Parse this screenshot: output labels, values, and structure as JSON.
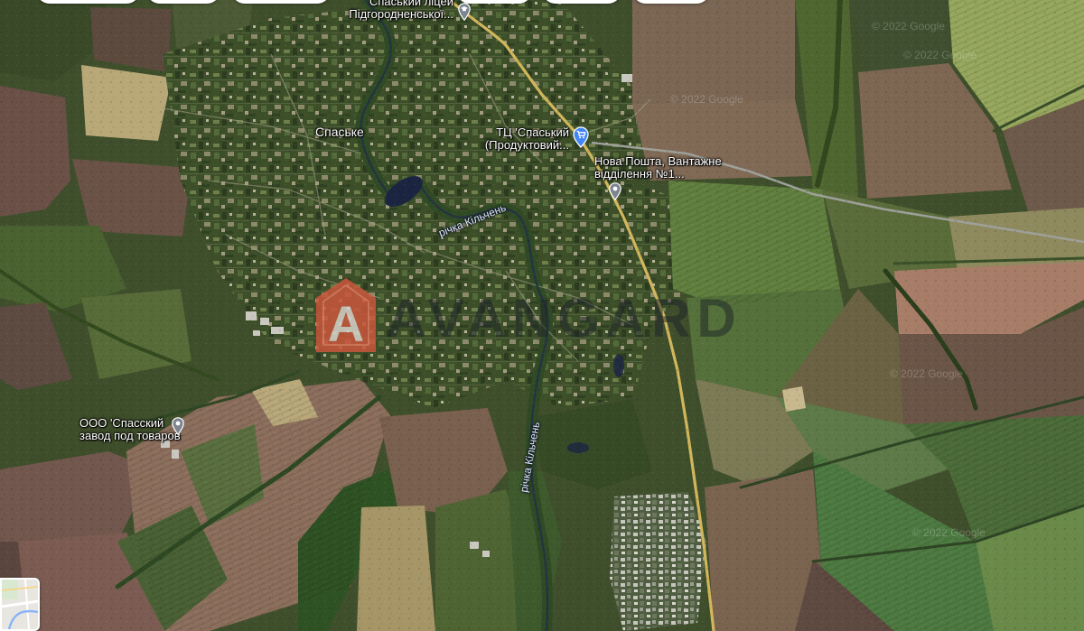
{
  "map": {
    "view": "satellite",
    "copyright": "© 2022 Google",
    "watermark": {
      "text": "AVANGARD",
      "logo_letter": "A",
      "logo_icon": "house-logo-icon"
    },
    "layers_button": {
      "icon": "layers-thumbnail-icon"
    }
  },
  "places": {
    "lyceum": {
      "line1": "Спаський ліцей",
      "line2": "Підгородненської...",
      "icon": "school-pin-icon"
    },
    "village": {
      "label": "Спаське"
    },
    "mall": {
      "line1": "ТЦ 'Спаський",
      "line2": "(Продуктовий...",
      "icon": "shopping-cart-pin-icon"
    },
    "post_office": {
      "line1": "Нова Пошта, Вантажне",
      "line2": "відділення №1...",
      "icon": "map-pin-icon"
    },
    "factory": {
      "line1": "ООО 'Спасский",
      "line2": "завод под товаров",
      "icon": "map-pin-icon"
    }
  },
  "rivers": [
    {
      "label": "річка Кільчень"
    },
    {
      "label": "річка Кільчень"
    }
  ],
  "colors": {
    "major_road": "#d2b65c",
    "minor_road": "#9ea09a",
    "water": "#1b2542",
    "pin_blue": "#4285F4",
    "pin_gray": "#7d8590",
    "watermark_logo": "#c9553b"
  }
}
